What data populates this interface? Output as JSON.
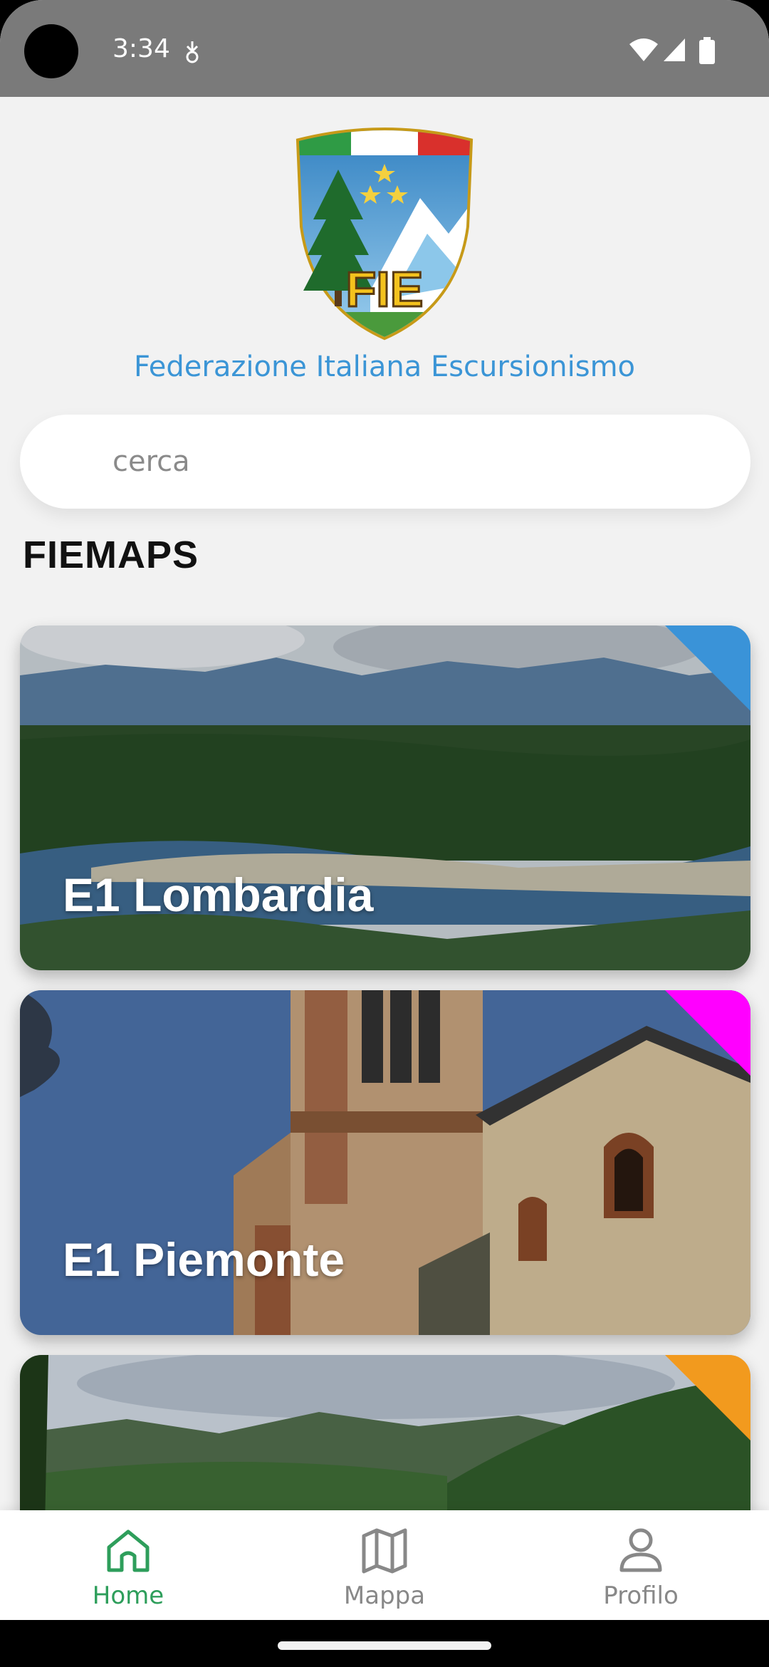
{
  "status_bar": {
    "time": "3:34",
    "icons": [
      "data-saver-icon",
      "wifi-icon",
      "signal-icon",
      "battery-icon"
    ]
  },
  "header": {
    "logo_text": "FIE",
    "org_name": "Federazione Italiana Escursionismo"
  },
  "search": {
    "placeholder": "cerca"
  },
  "section": {
    "title": "FIEMAPS"
  },
  "cards": [
    {
      "title": "E1 Lombardia",
      "corner_color": "#3a93d8",
      "image": "river-valley-landscape"
    },
    {
      "title": "E1 Piemonte",
      "corner_color": "#ff00ff",
      "image": "church-bell-tower"
    },
    {
      "title": "",
      "corner_color": "#f29a1e",
      "image": "green-hills-landscape"
    }
  ],
  "bottom_nav": {
    "active_color": "#2e9e5b",
    "inactive_color": "#888888",
    "items": [
      {
        "label": "Home",
        "icon": "home-icon",
        "active": true
      },
      {
        "label": "Mappa",
        "icon": "map-icon",
        "active": false
      },
      {
        "label": "Profilo",
        "icon": "profile-icon",
        "active": false
      }
    ]
  }
}
